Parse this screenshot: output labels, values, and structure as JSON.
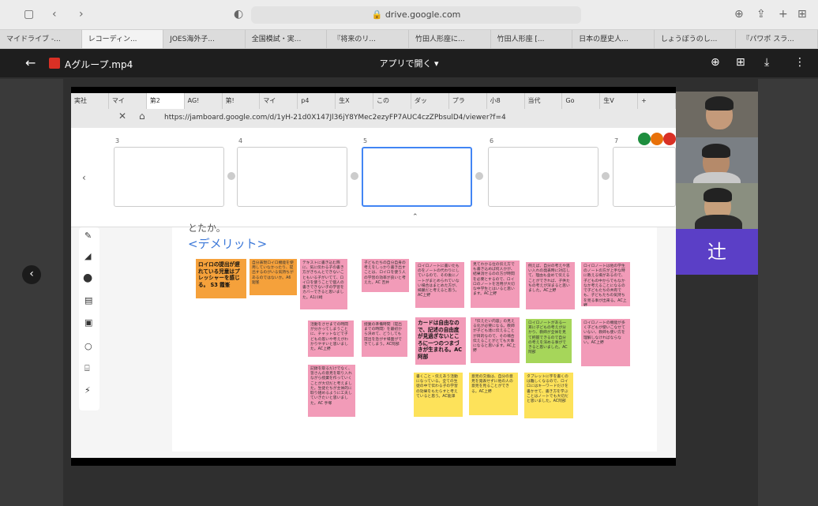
{
  "safari": {
    "url": "drive.google.com",
    "tabs": [
      "マイドライブ -...",
      "レコーディン...",
      "JOES海外子...",
      "全国模試・実...",
      "『将来のリ...",
      "竹田人形座に...",
      "竹田人形座 [...",
      "日本の歴史人...",
      "しょうぼうのし...",
      "『パワポ スラ..."
    ]
  },
  "drive_preview": {
    "file_name": "Aグループ.mp4",
    "open_with": "アプリで開く",
    "open_with_arrow": "▾"
  },
  "inner_browser": {
    "tabs": [
      "実社",
      "マイ",
      "第2",
      "AG!",
      "第!",
      "マイ",
      "p4",
      "生X",
      "この",
      "ダッ",
      "プラ",
      "小8",
      "当代",
      "Go",
      "生V",
      "+"
    ],
    "url": "https://jamboard.google.com/d/1yH-21d0X147Jl36jY8YMec2ezyFP7AUC4czZPbsulD4/viewer?f=4"
  },
  "slides": {
    "numbers": [
      "3",
      "4",
      "5",
      "6",
      "7"
    ],
    "left_arrow": "‹",
    "collapse": "⌃"
  },
  "canvas": {
    "prev_text": "とたか。",
    "title": "<デメリット>",
    "notes": [
      {
        "id": "n1",
        "color": "orange",
        "big": true,
        "text": "ロイロの提出が遅れている児童はプレッシャーを感じる。 S3 霞峯"
      },
      {
        "id": "n2",
        "color": "orange",
        "big": false,
        "text": "自分表現ロイロ機能を使用していなかったり、提出するのがいる気持ちがあるのではないか。A6廻峯"
      },
      {
        "id": "n3",
        "color": "pink",
        "big": false,
        "text": "テキストに書き込む際に、気に伝わる子の書き方がきちんとできないこともいる子がいてて、ロイロを使うことで個人の書きできない子の学習をカバーできると思いました。A1川崎"
      },
      {
        "id": "n4",
        "color": "pink",
        "big": false,
        "text": "子どもたちの自分自身の考えをしっかり書き出すことは、ロイロを使う人の学習の効率が良いと考えた。AC 吉井"
      },
      {
        "id": "n5",
        "color": "pink",
        "big": false,
        "text": "ロイロノートに書いたものをノートの代わりにしているので、その後にノートがまとめられていない場合はまとめた方が、綺麗だと考えると思う。AC上野"
      },
      {
        "id": "n6",
        "color": "pink",
        "big": false,
        "text": "見てわかる位の伝え方でも書き込めば何人かが、結果消せるのの方が時間を必要とするので、ロイロのノートを活用が大切な中学生とはいると思います。AC上野"
      },
      {
        "id": "n7",
        "color": "pink",
        "big": false,
        "text": "例えば、自分の考えや思い入れの発表時に対応して、理由も含めて伝えることができれば、子供たちの考えが深まると思いました。AC上野"
      },
      {
        "id": "n8",
        "color": "pink",
        "big": false,
        "text": "ロイロノートは他の学生のノートの方が上手な時に教える場があるので、子どもの中からでもなかなか考えることになるので子どもたちの共有でも、子どもたちの気持ちを見る事が出来る。AC上野"
      },
      {
        "id": "n9",
        "color": "pink",
        "big": false,
        "text": "活動をさせまでの時間が分かってしまうことに、チャットなどで子どもの思いや考えがわかりやすいと思いました。AC上野"
      },
      {
        "id": "n10",
        "color": "pink",
        "big": false,
        "text": "授業の準備時間（提出までの時間）を最初から決めて、どうしても提出を急がす場面ができてしまう。AC阿部"
      },
      {
        "id": "n11",
        "color": "pink",
        "big": true,
        "text": "カードは自由なので、記述の自由度が見過ぎないところに一つのつまづきが生まれる。AC阿部"
      },
      {
        "id": "n12",
        "color": "pink",
        "big": false,
        "text": "「伝えたい内容」の見える化が必要になる。教師が子ども達に伝えることが目的なので、その場合伝えることがとても大事になると思います。AC上野"
      },
      {
        "id": "n13",
        "color": "green",
        "big": false,
        "text": "ロイロノートがある一斉に子どもの考えが分かり、教師が全体を見て把握できるので自分の考えを深める事ができると思いました。AC阿部"
      },
      {
        "id": "n14",
        "color": "pink",
        "big": false,
        "text": "ロイロノートの機能が多く子どもが使いこなせていない、教師も使い方を理解しなければならない。AC上野"
      },
      {
        "id": "n15",
        "color": "pink",
        "big": false,
        "text": "記録を取るだけでなく、皆さんの意見を取り入れながら授業を作っていくことが大切だと考えました。生徒たちが主体的に取り組めるように工夫していきたいと思いました。AC 手塚"
      },
      {
        "id": "n16",
        "color": "yellow",
        "big": false,
        "text": "書くこと・伝えあう活動になっている。全ての生徒の中で伝わる子の学習の効果をもたらすと考えていると思う。AC能澤"
      },
      {
        "id": "n17",
        "color": "yellow",
        "big": false,
        "text": "意見の交換は、自分の意見を発表せずに他の人の意見を見ることができる。AC上野"
      },
      {
        "id": "n18",
        "color": "yellow",
        "big": false,
        "text": "タブレットに字を書くのは難しくなるので、ロイロにはキーワードだけを書かせて、書き方を学ぶことはノートでも大切だと思いました。AC阿部"
      }
    ]
  },
  "participants": {
    "name_tile": "辻"
  },
  "colors": {
    "orange": "#f5a13b",
    "pink": "#f29bb8",
    "yellow": "#fde25a",
    "green": "#a6d65a",
    "accent": "#4285f4"
  }
}
